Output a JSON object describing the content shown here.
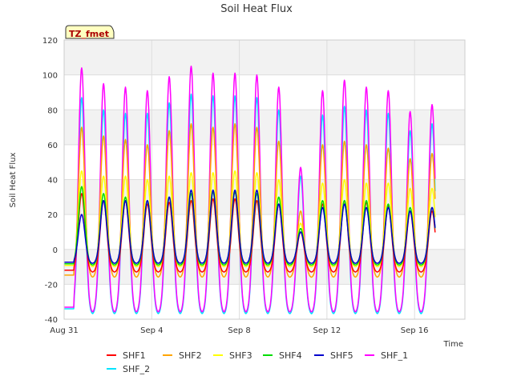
{
  "chart_data": {
    "type": "line",
    "title": "Soil Heat Flux",
    "xlabel": "Time",
    "ylabel": "Soil Heat Flux",
    "badge": "TZ_fmet",
    "ylim": [
      -40,
      120
    ],
    "yticks": [
      -40,
      -20,
      0,
      20,
      40,
      60,
      80,
      100,
      120
    ],
    "xlim_days": [
      0,
      18.3
    ],
    "xticks": [
      {
        "day": 0,
        "label": "Aug 31"
      },
      {
        "day": 4,
        "label": "Sep 4"
      },
      {
        "day": 8,
        "label": "Sep 8"
      },
      {
        "day": 12,
        "label": "Sep 12"
      },
      {
        "day": 16,
        "label": "Sep 16"
      }
    ],
    "grid": true,
    "legend_position": "bottom",
    "peak_days": [
      0.8,
      1.8,
      2.8,
      3.8,
      4.8,
      5.8,
      6.8,
      7.8,
      8.8,
      9.8,
      10.8,
      11.8,
      12.8,
      13.8,
      14.8,
      15.8,
      16.8
    ],
    "series": [
      {
        "name": "SHF1",
        "color": "#ff0000",
        "min": -13,
        "peaks": [
          32,
          28,
          28,
          26,
          27,
          28,
          29,
          29,
          28,
          26,
          10,
          26,
          28,
          27,
          25,
          22,
          22
        ]
      },
      {
        "name": "SHF2",
        "color": "#ffa500",
        "min": -16,
        "peaks": [
          70,
          65,
          63,
          60,
          68,
          72,
          70,
          72,
          70,
          62,
          22,
          60,
          62,
          60,
          58,
          52,
          55
        ]
      },
      {
        "name": "SHF3",
        "color": "#ffff00",
        "min": -10,
        "peaks": [
          45,
          42,
          42,
          40,
          42,
          44,
          44,
          45,
          44,
          40,
          15,
          38,
          40,
          38,
          38,
          35,
          35
        ]
      },
      {
        "name": "SHF4",
        "color": "#00dd00",
        "min": -9,
        "peaks": [
          36,
          32,
          30,
          28,
          30,
          32,
          33,
          33,
          32,
          30,
          12,
          28,
          28,
          28,
          26,
          24,
          24
        ]
      },
      {
        "name": "SHF5",
        "color": "#0000cc",
        "min": -8,
        "peaks": [
          20,
          28,
          28,
          28,
          30,
          34,
          34,
          34,
          34,
          26,
          10,
          24,
          26,
          24,
          24,
          22,
          24
        ]
      },
      {
        "name": "SHF_1",
        "color": "#ff00ff",
        "min": -36,
        "peaks": [
          104,
          95,
          93,
          91,
          99,
          105,
          101,
          101,
          100,
          93,
          47,
          91,
          97,
          93,
          91,
          79,
          83
        ]
      },
      {
        "name": "SHF_2",
        "color": "#00e5ff",
        "min": -37,
        "peaks": [
          87,
          80,
          78,
          78,
          84,
          89,
          88,
          88,
          87,
          80,
          42,
          77,
          82,
          80,
          78,
          68,
          72
        ]
      }
    ]
  }
}
